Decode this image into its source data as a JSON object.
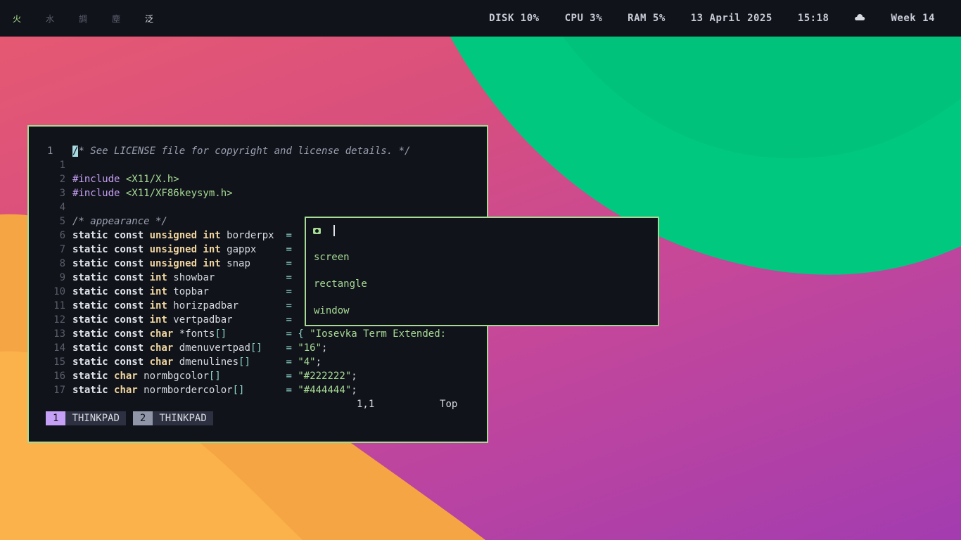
{
  "taskbar": {
    "tags": [
      {
        "label": "火",
        "state": "active"
      },
      {
        "label": "水",
        "state": "empty"
      },
      {
        "label": "調",
        "state": "empty"
      },
      {
        "label": "塵",
        "state": "empty"
      },
      {
        "label": "泛",
        "state": "occupied"
      }
    ],
    "disk": "DISK 10%",
    "cpu": "CPU 3%",
    "ram": "RAM 5%",
    "date": "13 April 2025",
    "time": "15:18",
    "weather_icon": "cloud-icon",
    "week": "Week 14"
  },
  "editor": {
    "lines": [
      {
        "num": "1",
        "text": "/* See LICENSE file for copyright and license details. */"
      },
      {
        "num": "1",
        "text": ""
      },
      {
        "num": "2",
        "text": "#include <X11/X.h>"
      },
      {
        "num": "3",
        "text": "#include <X11/XF86keysym.h>"
      },
      {
        "num": "4",
        "text": ""
      },
      {
        "num": "5",
        "text": "/* appearance */"
      },
      {
        "num": "6",
        "text": "static const unsigned int borderpx  ="
      },
      {
        "num": "7",
        "text": "static const unsigned int gappx     ="
      },
      {
        "num": "8",
        "text": "static const unsigned int snap      ="
      },
      {
        "num": "9",
        "text": "static const int showbar            ="
      },
      {
        "num": "10",
        "text": "static const int topbar             ="
      },
      {
        "num": "11",
        "text": "static const int horizpadbar        ="
      },
      {
        "num": "12",
        "text": "static const int vertpadbar         ="
      },
      {
        "num": "13",
        "text": "static const char *fonts[]          = { \"Iosevka Term Extended:"
      },
      {
        "num": "14",
        "text": "static const char dmenuvertpad[]    = \"16\";"
      },
      {
        "num": "15",
        "text": "static const char dmenulines[]      = \"4\";"
      },
      {
        "num": "16",
        "text": "static char normbgcolor[]           = \"#222222\";"
      },
      {
        "num": "17",
        "text": "static char normbordercolor[]       = \"#444444\";"
      }
    ],
    "position": "1,1",
    "scroll": "Top"
  },
  "tmux": {
    "windows": [
      {
        "index": "1",
        "name": "THINKPAD"
      },
      {
        "index": "2",
        "name": "THINKPAD"
      }
    ]
  },
  "dmenu": {
    "prompt_icon": "camera-icon",
    "input_value": "",
    "options": [
      "screen",
      "rectangle",
      "window"
    ]
  },
  "colors": {
    "accent": "#a6da95",
    "bar_bg": "#11131a",
    "purple": "#c6a0f6"
  }
}
